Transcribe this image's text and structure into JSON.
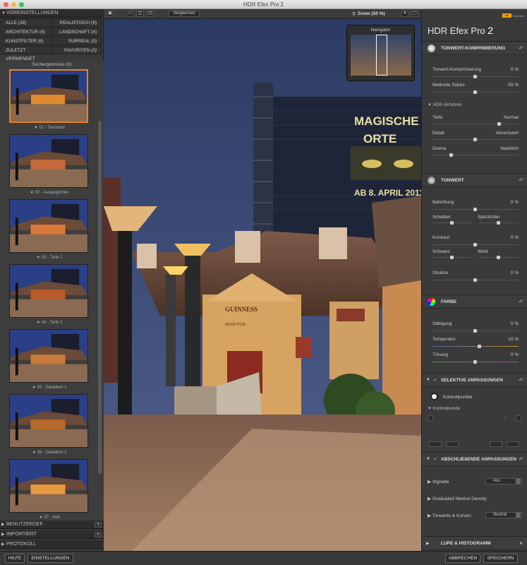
{
  "window": {
    "title": "HDR Efex Pro 2"
  },
  "left_panel": {
    "presets_header": "VOREINSTELLUNGEN",
    "categories": [
      {
        "label": "ALLE (28)",
        "italic": false
      },
      {
        "label": "REALISTISCH (9)",
        "italic": false
      },
      {
        "label": "ARCHITEKTUR (4)",
        "italic": false
      },
      {
        "label": "LANDSCHAFT (4)",
        "italic": false
      },
      {
        "label": "KUNSTFILTER (6)",
        "italic": false
      },
      {
        "label": "SURREAL (5)",
        "italic": false
      },
      {
        "label": "ZULETZT VERWENDET",
        "italic": true
      },
      {
        "label": "FAVORITEN (0)",
        "italic": true
      }
    ],
    "results_header": "Suchergebnisse (9)",
    "thumbnails": [
      {
        "label": "★ 01 - Standard",
        "selected": true
      },
      {
        "label": "★ 02 - Ausgeglichen",
        "selected": false
      },
      {
        "label": "★ 03 - Tiefe 1",
        "selected": false
      },
      {
        "label": "★ 04 - Tiefe 2",
        "selected": false
      },
      {
        "label": "★ 05 - Detailliert 1",
        "selected": false
      },
      {
        "label": "★ 06 - Detailliert 2",
        "selected": false
      },
      {
        "label": "★ 07 - Hell",
        "selected": false
      }
    ],
    "bottom_sections": [
      "BENUTZERDEF.",
      "IMPORTIERT",
      "PROTOKOLL"
    ]
  },
  "toolbar": {
    "compare_label": "Vergleichen",
    "zoom_label": "Zoom (50 %)"
  },
  "canvas": {
    "navigator_title": "Navigator",
    "sign_line1": "MAGISCHE",
    "sign_line2": "ORTE",
    "sign_date": "AB 8. APRIL 2011",
    "pub_name": "GUINNESS",
    "pub_sub": "IRISH PUB"
  },
  "right_panel": {
    "brand": "HDR Efex Pro",
    "brand_num": "2",
    "badge": "nik",
    "badge_sub": "Collection",
    "sections": {
      "tonwert_komp": {
        "title": "TONWERT-KOMPRIMIERUNG",
        "rows": [
          {
            "label": "Tonwert-Komprimierung",
            "value": "0 %"
          },
          {
            "label": "Methode Stärke",
            "value": "50 %"
          }
        ],
        "hdr_title": "HDR-Verfahren",
        "tiefe_label": "Tiefe",
        "tiefe_value": "Normal",
        "detail_label": "Detail",
        "detail_value": "Akzentuiert",
        "drama_label": "Drama",
        "drama_value": "Natürlich"
      },
      "tonwert": {
        "title": "TONWERT",
        "belichtung": {
          "label": "Belichtung",
          "value": "0 %"
        },
        "schatten": "Schatten",
        "spitzlichter": "Spitzlichter",
        "kontrast": {
          "label": "Kontrast",
          "value": "0 %"
        },
        "schwarz": "Schwarz",
        "weiss": "Weiß",
        "struktur": {
          "label": "Struktur",
          "value": "0 %"
        }
      },
      "farbe": {
        "title": "FARBE",
        "saettigung": {
          "label": "Sättigung",
          "value": "0 %"
        },
        "temperatur": {
          "label": "Temperatur",
          "value": "10 %"
        },
        "toenung": {
          "label": "Tönung",
          "value": "0 %"
        }
      },
      "selektiv": {
        "title": "SELEKTIVE ANPASSUNGEN",
        "kontrollpunkte_btn": "Kontrollpunkte",
        "kontrollpunkte_sub": "Kontrollpunkte"
      },
      "abschliessend": {
        "title": "ABSCHLIEßENDE ANPASSUNGEN",
        "vignette": "Vignette",
        "vignette_value": "Aus",
        "gnd": "Graduated Neutral Density",
        "kurven": "Tonwerte & Kurven",
        "kurven_value": "Neutral"
      },
      "lupe": {
        "title": "LUPE & HISTOGRAMM"
      }
    }
  },
  "bottom_bar": {
    "help": "HILFE",
    "settings": "EINSTELLUNGEN",
    "cancel": "ABBRECHEN",
    "save": "SPEICHERN"
  },
  "colors": {
    "accent": "#e8821e",
    "panel": "#3a3a3a"
  }
}
